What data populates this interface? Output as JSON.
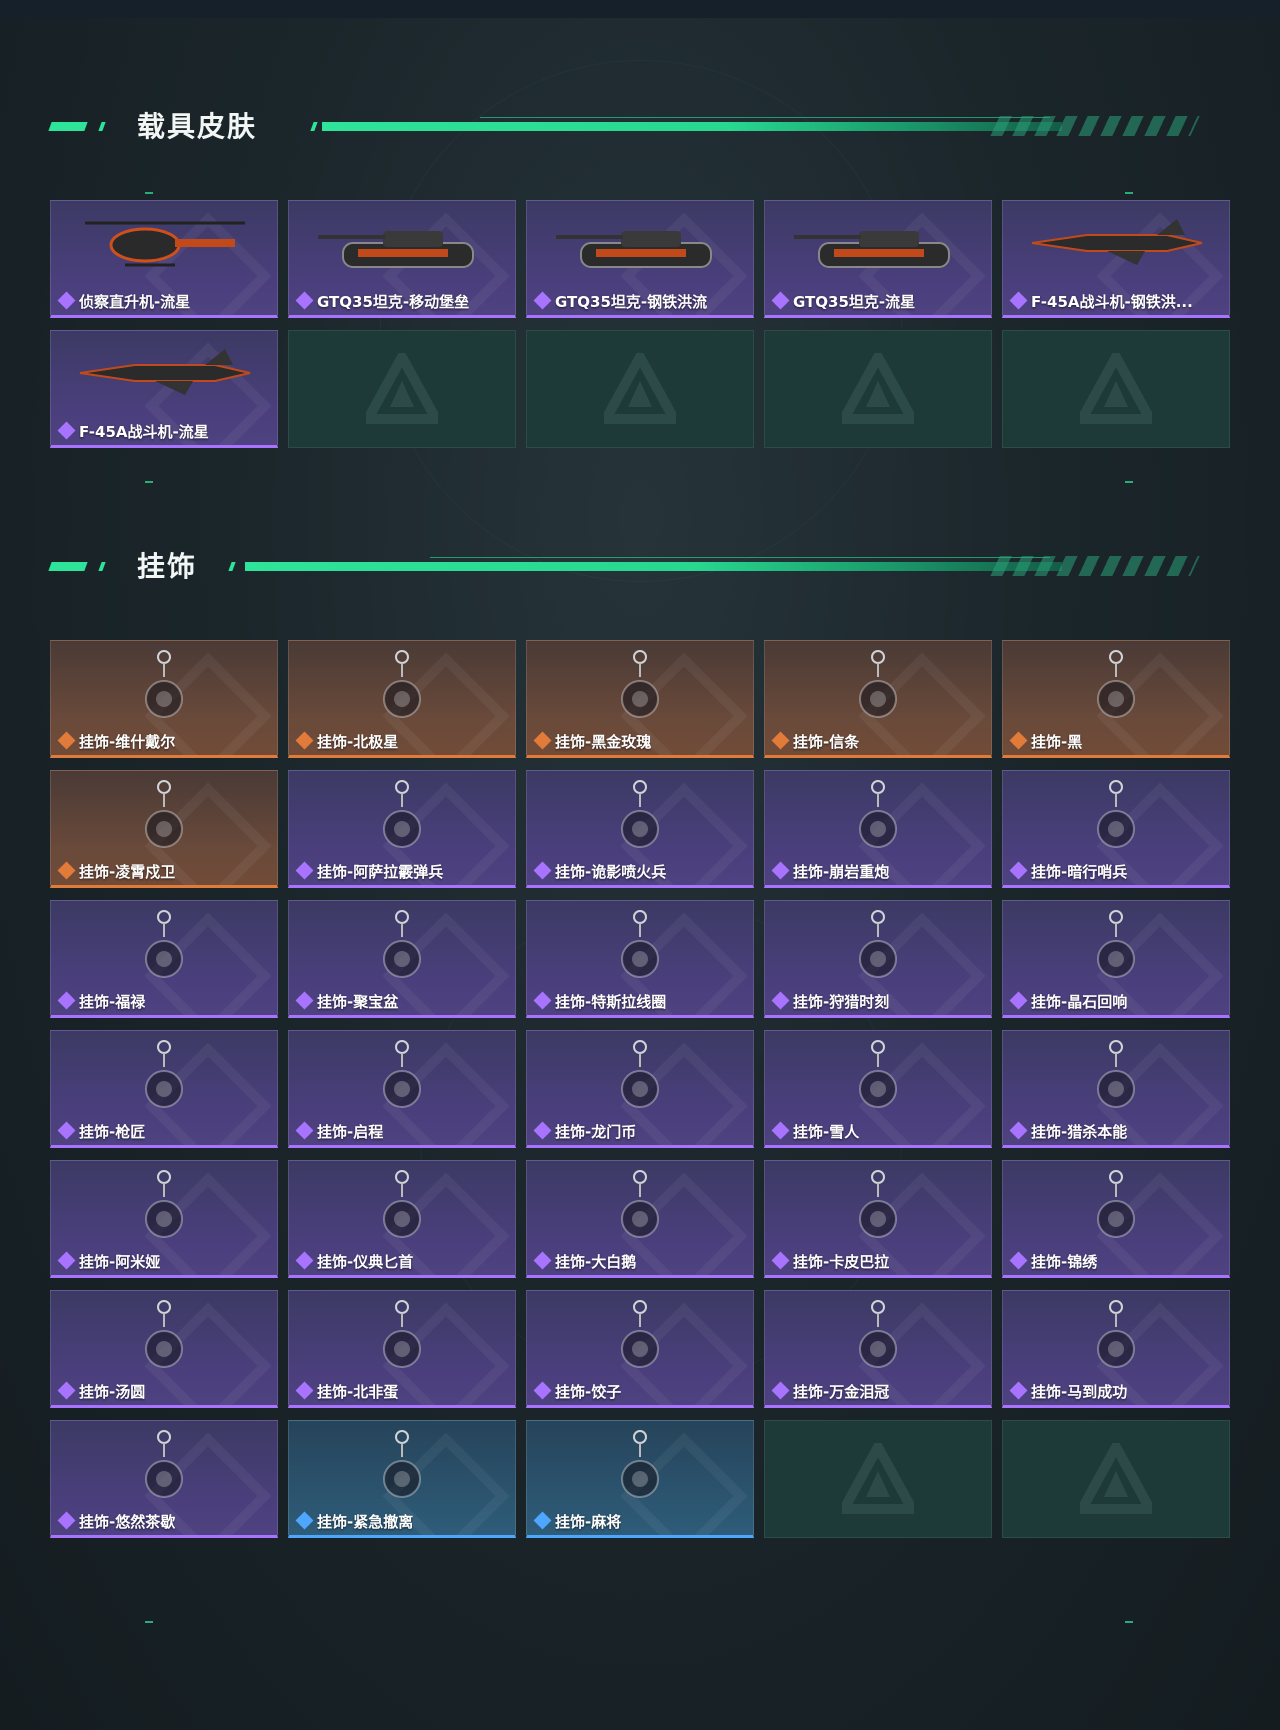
{
  "sections": [
    {
      "title": "载具皮肤"
    },
    {
      "title": "挂饰"
    }
  ],
  "colors": {
    "accent": "#2ee39a",
    "purple": "#a874ff",
    "orange": "#e07b3a",
    "blue": "#4ea6ff",
    "empty": "#1e3a38"
  },
  "vehicles": [
    {
      "label": "侦察直升机-流星",
      "rarity": "purple",
      "icon": "helicopter-icon"
    },
    {
      "label": "GTQ35坦克-移动堡垒",
      "rarity": "purple",
      "icon": "tank-icon"
    },
    {
      "label": "GTQ35坦克-钢铁洪流",
      "rarity": "purple",
      "icon": "tank-icon"
    },
    {
      "label": "GTQ35坦克-流星",
      "rarity": "purple",
      "icon": "tank-icon"
    },
    {
      "label": "F-45A战斗机-钢铁洪...",
      "rarity": "purple",
      "icon": "fighter-jet-icon"
    },
    {
      "label": "F-45A战斗机-流星",
      "rarity": "purple",
      "icon": "fighter-jet-icon"
    }
  ],
  "charms": [
    {
      "label": "挂饰-维什戴尔",
      "rarity": "orange"
    },
    {
      "label": "挂饰-北极星",
      "rarity": "orange"
    },
    {
      "label": "挂饰-黑金玫瑰",
      "rarity": "orange"
    },
    {
      "label": "挂饰-信条",
      "rarity": "orange"
    },
    {
      "label": "挂饰-黑",
      "rarity": "orange"
    },
    {
      "label": "挂饰-凌霄戍卫",
      "rarity": "orange"
    },
    {
      "label": "挂饰-阿萨拉霰弹兵",
      "rarity": "purple"
    },
    {
      "label": "挂饰-诡影喷火兵",
      "rarity": "purple"
    },
    {
      "label": "挂饰-崩岩重炮",
      "rarity": "purple"
    },
    {
      "label": "挂饰-暗行哨兵",
      "rarity": "purple"
    },
    {
      "label": "挂饰-福禄",
      "rarity": "purple"
    },
    {
      "label": "挂饰-聚宝盆",
      "rarity": "purple"
    },
    {
      "label": "挂饰-特斯拉线圈",
      "rarity": "purple"
    },
    {
      "label": "挂饰-狩猎时刻",
      "rarity": "purple"
    },
    {
      "label": "挂饰-晶石回响",
      "rarity": "purple"
    },
    {
      "label": "挂饰-枪匠",
      "rarity": "purple"
    },
    {
      "label": "挂饰-启程",
      "rarity": "purple"
    },
    {
      "label": "挂饰-龙门币",
      "rarity": "purple"
    },
    {
      "label": "挂饰-雪人",
      "rarity": "purple"
    },
    {
      "label": "挂饰-猎杀本能",
      "rarity": "purple"
    },
    {
      "label": "挂饰-阿米娅",
      "rarity": "purple"
    },
    {
      "label": "挂饰-仪典匕首",
      "rarity": "purple"
    },
    {
      "label": "挂饰-大白鹅",
      "rarity": "purple"
    },
    {
      "label": "挂饰-卡皮巴拉",
      "rarity": "purple"
    },
    {
      "label": "挂饰-锦绣",
      "rarity": "purple"
    },
    {
      "label": "挂饰-汤圆",
      "rarity": "purple"
    },
    {
      "label": "挂饰-北非蛋",
      "rarity": "purple"
    },
    {
      "label": "挂饰-饺子",
      "rarity": "purple"
    },
    {
      "label": "挂饰-万金泪冠",
      "rarity": "purple"
    },
    {
      "label": "挂饰-马到成功",
      "rarity": "purple"
    },
    {
      "label": "挂饰-悠然茶歇",
      "rarity": "purple"
    },
    {
      "label": "挂饰-紧急撤离",
      "rarity": "blue"
    },
    {
      "label": "挂饰-麻将",
      "rarity": "blue"
    }
  ]
}
